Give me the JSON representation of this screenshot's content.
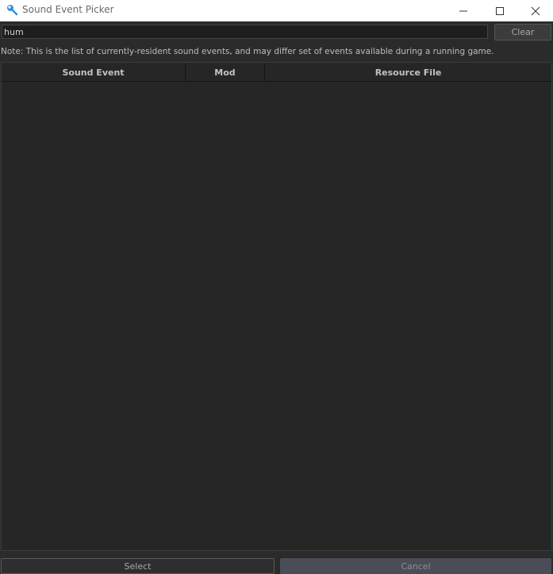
{
  "window": {
    "title": "Sound Event Picker",
    "icons": {
      "app": "wrench-icon",
      "minimize": "minimize-icon",
      "maximize": "maximize-icon",
      "close": "close-icon"
    }
  },
  "search": {
    "value": "hum"
  },
  "clear_label": "Clear",
  "note": "Note: This is the list of currently-resident sound events, and may differ set of events available during a running game.",
  "table": {
    "columns": [
      "Sound Event",
      "Mod",
      "Resource File"
    ],
    "rows": []
  },
  "footer": {
    "select_label": "Select",
    "cancel_label": "Cancel"
  },
  "colors": {
    "background": "#2b2b2b",
    "table_bg": "#262626",
    "accent_icon": "#3a8fd6"
  }
}
